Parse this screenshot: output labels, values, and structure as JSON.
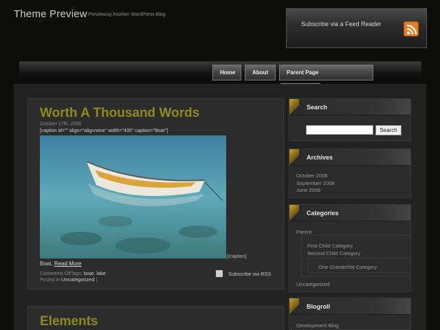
{
  "header": {
    "site_title": "Theme Preview",
    "tagline": "Previewing Another WordPress Blog",
    "feed_label": "Subscribe via a Feed Reader"
  },
  "nav": {
    "home": "Home",
    "about": "About",
    "parent_page": "Parent Page"
  },
  "posts": [
    {
      "title": "Worth A Thousand Words",
      "date": "October 17th, 2008",
      "caption_code": "[caption id=\"\" align=\"alignnone\" width=\"435\" caption=\"Boat\"]",
      "caption_end": "[/caption]",
      "caption_text": "Boat.",
      "read_more": "Read More",
      "meta_comments": "Comments Off",
      "meta_tags_label": "Tags:",
      "tags": [
        "boat",
        "lake"
      ],
      "posted_in_label": "Posted in",
      "category": "Uncategorized",
      "category_sep": "|",
      "rss_label": "Subscribe via RSS"
    },
    {
      "title": "Elements"
    }
  ],
  "sidebar": {
    "search": {
      "title": "Search",
      "button": "Search",
      "value": ""
    },
    "archives": {
      "title": "Archives",
      "items": [
        "October 2008",
        "September 2008",
        "June 2008"
      ]
    },
    "categories": {
      "title": "Categories",
      "parent": "Parent",
      "children": [
        "First Child Category",
        "Second Child Category"
      ],
      "grandchild": "One Grandchild Category",
      "uncategorized": "Uncategorized"
    },
    "blogroll": {
      "title": "Blogroll",
      "items": [
        "Development Blog"
      ]
    }
  },
  "icons": {
    "feed": "rss-icon",
    "rss_small": "rss-icon"
  },
  "colors": {
    "post_title": "#8f8a1c",
    "background": "#0d0d0a",
    "rss_orange": "#e67c22"
  }
}
